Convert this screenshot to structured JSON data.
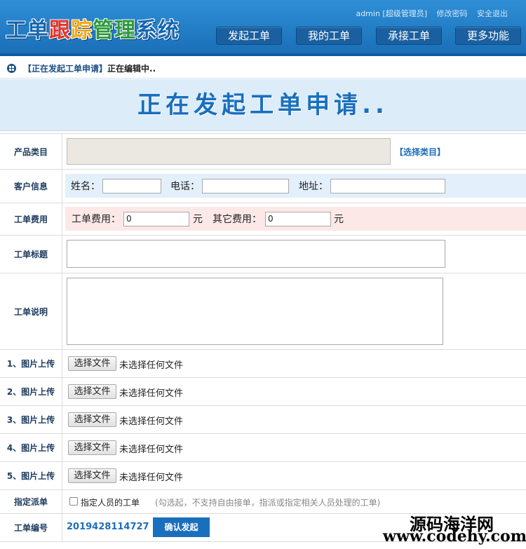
{
  "header": {
    "logo_parts": [
      "工单",
      "跟",
      "踪",
      "管理",
      "系统"
    ],
    "user": "admin [超级管理员]",
    "change_password": "修改密码",
    "logout": "安全退出",
    "nav": [
      "发起工单",
      "我的工单",
      "承接工单",
      "更多功能"
    ]
  },
  "breadcrumb": {
    "current": "【正在发起工单申请】",
    "status": "正在编辑中.."
  },
  "banner": {
    "title": "正在发起工单申请.."
  },
  "form": {
    "category": {
      "label": "产品类目",
      "select_link": "【选择类目】"
    },
    "customer": {
      "label": "客户信息",
      "name_label": "姓名：",
      "phone_label": "电话：",
      "address_label": "地址："
    },
    "fee": {
      "label": "工单费用",
      "fee_label": "工单费用：",
      "fee_value": "0",
      "unit1": "元",
      "other_label": "其它费用：",
      "other_value": "0",
      "unit2": "元"
    },
    "title": {
      "label": "工单标题"
    },
    "desc": {
      "label": "工单说明"
    },
    "uploads": [
      {
        "label": "1、图片上传",
        "button": "选择文件",
        "status": "未选择任何文件"
      },
      {
        "label": "2、图片上传",
        "button": "选择文件",
        "status": "未选择任何文件"
      },
      {
        "label": "3、图片上传",
        "button": "选择文件",
        "status": "未选择任何文件"
      },
      {
        "label": "4、图片上传",
        "button": "选择文件",
        "status": "未选择任何文件"
      },
      {
        "label": "5、图片上传",
        "button": "选择文件",
        "status": "未选择任何文件"
      }
    ],
    "assign": {
      "label": "指定派单",
      "checkbox_label": "指定人员的工单",
      "hint": "(勾选起，不支持自由接单，指派或指定相关人员处理的工单)"
    },
    "number": {
      "label": "工单编号",
      "value": "2019428114727",
      "submit": "确认发起"
    }
  },
  "watermark": {
    "line1": "源码海洋网",
    "line2": "www.codehy.com"
  },
  "colors": {
    "header_blue": "#1a6fb8",
    "accent": "#1466b0",
    "customer_bg": "#e3f0fb",
    "fee_bg": "#fde8e8"
  }
}
